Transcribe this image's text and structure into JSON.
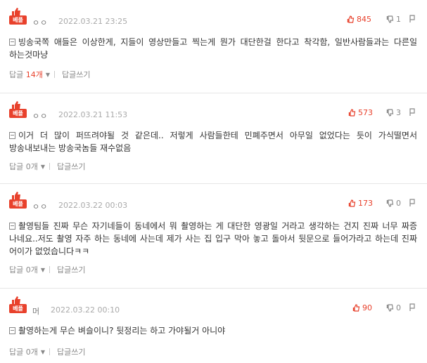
{
  "comments": [
    {
      "badge": "베플",
      "nick": "ㅇㅇ",
      "date": "2022.03.21 23:25",
      "up": "845",
      "down": "1",
      "text": "빙송국쪽 애들은 이상한게, 지들이 영상만들고 찍는게 뭔가 대단한걸 한다고 착각함, 일반사람들과는 다른일 하는것마냥",
      "reply_label": "답글",
      "reply_count": "14개",
      "write_label": "답글쓰기"
    },
    {
      "badge": "베플",
      "nick": "ㅇㅇ",
      "date": "2022.03.21 11:53",
      "up": "573",
      "down": "3",
      "text": "이거 더 많이 퍼뜨려야될 것 같은데.. 저렇게 사람들한테 민폐주면서 아무일 없었다는 듯이 가식떨면서 방송내보내는 방송국놈들 재수없음",
      "reply_label": "답글",
      "reply_count": "0개",
      "write_label": "답글쓰기"
    },
    {
      "badge": "베플",
      "nick": "ㅇㅇ",
      "date": "2022.03.22 00:03",
      "up": "173",
      "down": "0",
      "text": "촬영팀들 진짜 무슨 자기네들이 동네에서 뭐 촬영하는 게 대단한 영광일 거라고 생각하는 건지 진짜 너무 짜증 나네요..저도 촬영 자주 하는 동네에 사는데 제가 사는 집 입구 막아 놓고 돌아서 뒷문으로 들어가라고 하는데 진짜 어이가 없었습니다ㅋㅋ",
      "reply_label": "답글",
      "reply_count": "0개",
      "write_label": "답글쓰기"
    },
    {
      "badge": "베플",
      "nick": "머",
      "date": "2022.03.22 00:10",
      "up": "90",
      "down": "0",
      "text": "촬영하는게 무슨 벼슬이니? 뒷정리는 하고 가야될거 아니야",
      "reply_label": "답글",
      "reply_count": "0개",
      "write_label": "답글쓰기"
    }
  ],
  "colors": {
    "accent": "#e8412c",
    "muted": "#888888",
    "date": "#aaaaaa"
  },
  "icons": [
    "thumbs-up-badge-icon",
    "thumbs-up-icon",
    "thumbs-down-icon",
    "report-icon",
    "document-icon",
    "caret-down-icon"
  ]
}
